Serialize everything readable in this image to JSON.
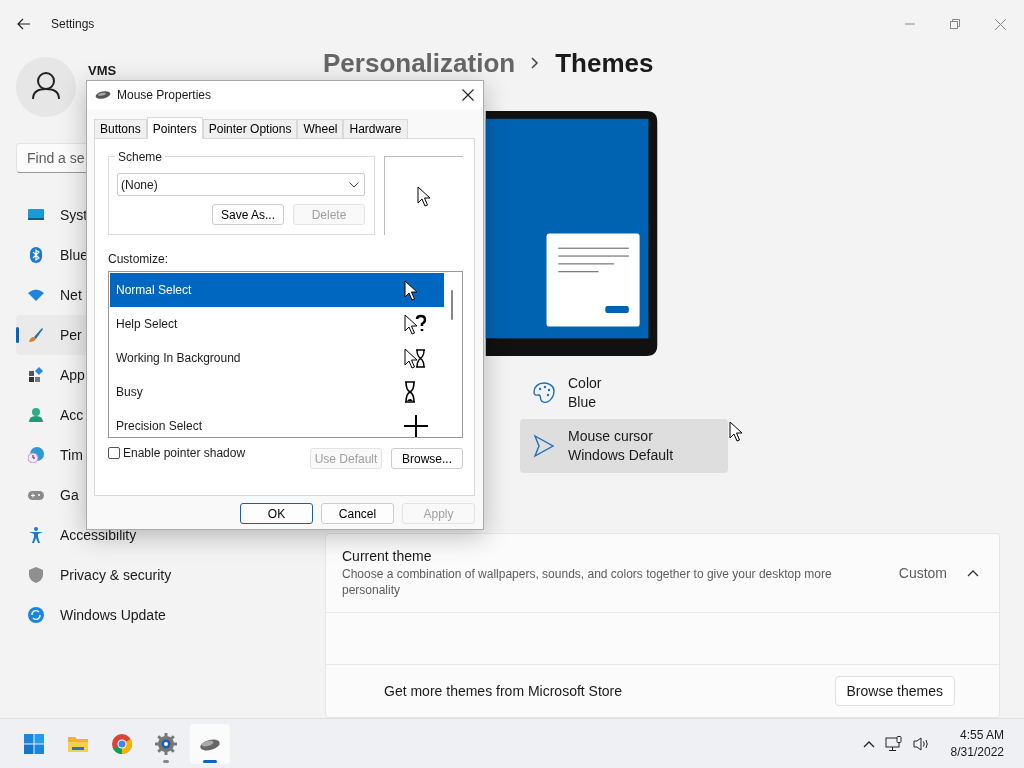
{
  "settings_window": {
    "title": "Settings",
    "user": {
      "name": "VMS"
    },
    "search": {
      "placeholder": "Find a se"
    },
    "sidebar": {
      "items": [
        {
          "label": "Syst",
          "selected": false
        },
        {
          "label": "Blue",
          "selected": false
        },
        {
          "label": "Net",
          "selected": false
        },
        {
          "label": "Per",
          "selected": true
        },
        {
          "label": "App",
          "selected": false
        },
        {
          "label": "Acc",
          "selected": false
        },
        {
          "label": "Tim",
          "selected": false
        },
        {
          "label": "Ga",
          "selected": false
        },
        {
          "label": "Accessibility",
          "selected": false
        },
        {
          "label": "Privacy & security",
          "selected": false
        },
        {
          "label": "Windows Update",
          "selected": false
        }
      ]
    },
    "breadcrumb": [
      "Personalization",
      "Themes"
    ],
    "theme_items": [
      {
        "title": "Color",
        "value": "Blue",
        "selected": false
      },
      {
        "title": "Mouse cursor",
        "value": "Windows Default",
        "selected": true
      }
    ],
    "current_theme": {
      "title": "Current theme",
      "description": "Choose a combination of wallpapers, sounds, and colors together to give your desktop more personality",
      "value": "Custom",
      "expanded": true
    },
    "store": {
      "text": "Get more themes from Microsoft Store",
      "button": "Browse themes"
    }
  },
  "dialog": {
    "title": "Mouse Properties",
    "tabs": [
      {
        "label": "Buttons",
        "selected": false
      },
      {
        "label": "Pointers",
        "selected": true
      },
      {
        "label": "Pointer Options",
        "selected": false
      },
      {
        "label": "Wheel",
        "selected": false
      },
      {
        "label": "Hardware",
        "selected": false
      }
    ],
    "scheme": {
      "label": "Scheme",
      "value": "(None)",
      "buttons": [
        {
          "label": "Save As...",
          "disabled": false
        },
        {
          "label": "Delete",
          "disabled": true
        }
      ]
    },
    "customize_label": "Customize:",
    "cursors": [
      {
        "label": "Normal Select",
        "selected": true
      },
      {
        "label": "Help Select",
        "selected": false
      },
      {
        "label": "Working In Background",
        "selected": false
      },
      {
        "label": "Busy",
        "selected": false
      },
      {
        "label": "Precision Select",
        "selected": false
      }
    ],
    "pointer_shadow": {
      "label": "Enable pointer shadow",
      "checked": false
    },
    "list_buttons": [
      {
        "label": "Use Default",
        "disabled": true
      },
      {
        "label": "Browse...",
        "disabled": false
      }
    ],
    "buttons": [
      {
        "label": "OK",
        "disabled": false,
        "default": true
      },
      {
        "label": "Cancel",
        "disabled": false,
        "default": false
      },
      {
        "label": "Apply",
        "disabled": true,
        "default": false
      }
    ]
  },
  "taskbar": {
    "apps": [
      {
        "active": false
      },
      {
        "active": false
      },
      {
        "active": false
      },
      {
        "active": false
      },
      {
        "active": true
      }
    ],
    "time": "4:55 AM",
    "date": "8/31/2022"
  }
}
